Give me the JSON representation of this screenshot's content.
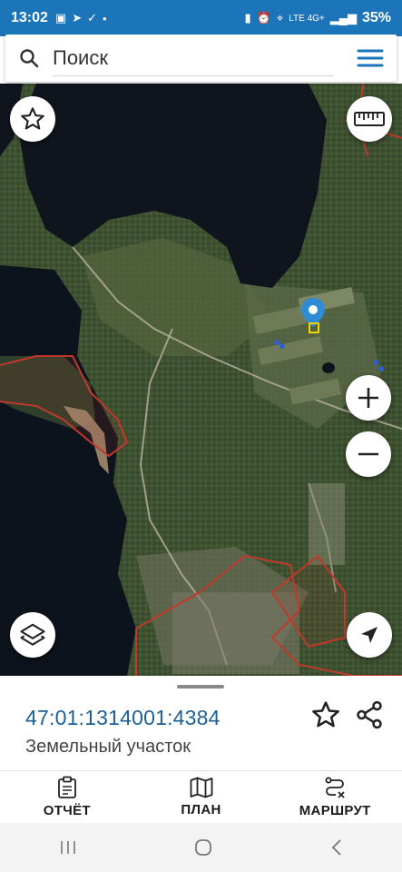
{
  "status_bar": {
    "time": "13:02",
    "battery": "35%",
    "network": "LTE 4G+"
  },
  "search": {
    "placeholder": "Поиск"
  },
  "parcel": {
    "cadastral_number": "47:01:1314001:4384",
    "type": "Земельный участок"
  },
  "bottom_nav": {
    "report": "ОТЧЁТ",
    "plan": "ПЛАН",
    "route": "МАРШРУТ"
  },
  "colors": {
    "accent": "#1b75b8",
    "parcel_link": "#1d5f97",
    "boundary": "#c0392b",
    "marker": "#2e8bd4"
  }
}
